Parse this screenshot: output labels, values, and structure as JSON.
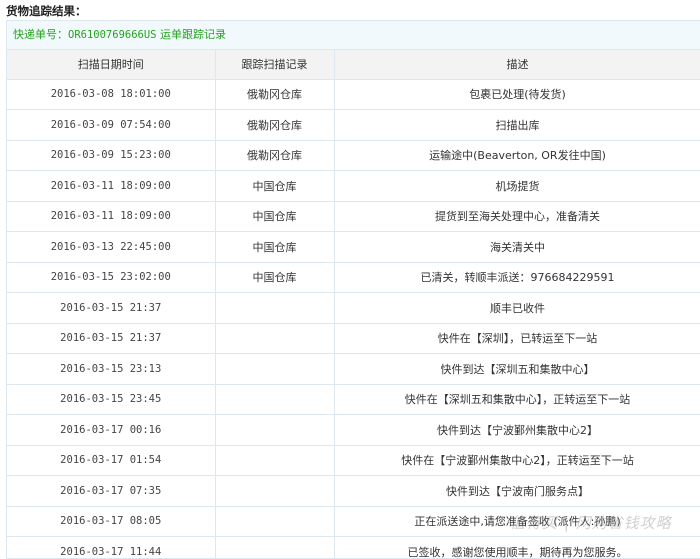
{
  "heading": "货物追踪结果：",
  "tracking_bar": {
    "label": "快递单号：",
    "number": "OR6100769666US",
    "link": "运单跟踪记录"
  },
  "table": {
    "headers": [
      "扫描日期时间",
      "跟踪扫描记录",
      "描述"
    ],
    "rows": [
      {
        "time": "2016-03-08 18:01:00",
        "location": "俄勒冈仓库",
        "desc": "包裹已处理(待发货)"
      },
      {
        "time": "2016-03-09 07:54:00",
        "location": "俄勒冈仓库",
        "desc": "扫描出库"
      },
      {
        "time": "2016-03-09 15:23:00",
        "location": "俄勒冈仓库",
        "desc": "运输途中(Beaverton, OR发往中国)"
      },
      {
        "time": "2016-03-11 18:09:00",
        "location": "中国仓库",
        "desc": "机场提货"
      },
      {
        "time": "2016-03-11 18:09:00",
        "location": "中国仓库",
        "desc": "提货到至海关处理中心，准备清关"
      },
      {
        "time": "2016-03-13 22:45:00",
        "location": "中国仓库",
        "desc": "海关清关中"
      },
      {
        "time": "2016-03-15 23:02:00",
        "location": "中国仓库",
        "desc": "已清关，转顺丰派送：976684229591"
      },
      {
        "time": "2016-03-15 21:37",
        "location": "",
        "desc": "顺丰已收件"
      },
      {
        "time": "2016-03-15 21:37",
        "location": "",
        "desc": "快件在【深圳】，已转运至下一站"
      },
      {
        "time": "2016-03-15 23:13",
        "location": "",
        "desc": "快件到达【深圳五和集散中心】"
      },
      {
        "time": "2016-03-15 23:45",
        "location": "",
        "desc": "快件在【深圳五和集散中心】，正转运至下一站"
      },
      {
        "time": "2016-03-17 00:16",
        "location": "",
        "desc": "快件到达【宁波鄞州集散中心2】"
      },
      {
        "time": "2016-03-17 01:54",
        "location": "",
        "desc": "快件在【宁波鄞州集散中心2】，正转运至下一站"
      },
      {
        "time": "2016-03-17 07:35",
        "location": "",
        "desc": "快件到达【宁波南门服务点】"
      },
      {
        "time": "2016-03-17 08:05",
        "location": "",
        "desc": "正在派送途中,请您准备签收 (派件人:孙鹏)"
      },
      {
        "time": "2016-03-17 11:44",
        "location": "",
        "desc": "已签收，感谢您使用顺丰，期待再为您服务。"
      }
    ]
  },
  "watermark": "值得买 | 网购省钱攻略"
}
